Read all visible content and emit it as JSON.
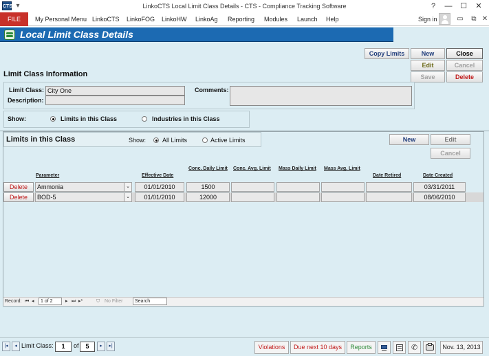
{
  "window": {
    "app_icon": "CTS",
    "title": "LinkoCTS Local Limit Class Details - CTS - Compliance Tracking Software",
    "min_glyph": "—",
    "max_glyph": "☐",
    "close_glyph": "✕"
  },
  "ribbon": {
    "file": "FILE",
    "menus": [
      "My Personal Menu",
      "LinkoCTS",
      "LinkoFOG",
      "LinkoHW",
      "LinkoAg",
      "Reporting",
      "Modules",
      "Launch",
      "Help"
    ],
    "sign_in": "Sign in"
  },
  "header": {
    "title": "Local Limit Class Details"
  },
  "actions": {
    "copy_limits": "Copy Limits",
    "new": "New",
    "close": "Close",
    "edit": "Edit",
    "cancel": "Cancel",
    "save": "Save",
    "delete": "Delete"
  },
  "info": {
    "section_title": "Limit Class Information",
    "limit_class_label": "Limit Class:",
    "limit_class_value": "City One",
    "description_label": "Description:",
    "description_value": "",
    "comments_label": "Comments:",
    "comments_value": "",
    "show_label": "Show:",
    "show_options": [
      "Limits in this Class",
      "Industries in this Class"
    ],
    "show_selected": "Limits in this Class"
  },
  "limits": {
    "title": "Limits in this Class",
    "show_label": "Show:",
    "filter_options": [
      "All Limits",
      "Active Limits"
    ],
    "filter_selected": "All Limits",
    "new": "New",
    "edit": "Edit",
    "cancel": "Cancel",
    "columns": {
      "parameter": "Parameter",
      "effective_date": "Effective Date",
      "conc_daily": "Conc. Daily Limit",
      "conc_avg": "Conc. Avg. Limit",
      "mass_daily": "Mass Daily Limit",
      "mass_avg": "Mass Avg. Limit",
      "date_retired": "Date Retired",
      "date_created": "Date Created"
    },
    "rows": [
      {
        "delete": "Delete",
        "parameter": "Ammonia",
        "effective_date": "01/01/2010",
        "conc_daily": "1500",
        "conc_avg": "",
        "mass_daily": "",
        "mass_avg": "",
        "date_retired": "",
        "date_created": "03/31/2011"
      },
      {
        "delete": "Delete",
        "parameter": "BOD-5",
        "effective_date": "01/01/2010",
        "conc_daily": "12000",
        "conc_avg": "",
        "mass_daily": "",
        "mass_avg": "",
        "date_retired": "",
        "date_created": "08/06/2010"
      }
    ]
  },
  "record_nav": {
    "label": "Record:",
    "position": "1 of 2",
    "filter": "No Filter",
    "search": "Search"
  },
  "status": {
    "limit_class_label": "Limit Class:",
    "current": "1",
    "of_label": "of",
    "total": "5",
    "violations": "Violations",
    "due_next": "Due next 10 days",
    "reports": "Reports",
    "date": "Nov. 13, 2013",
    "colors": {
      "violations": "#c11a1a",
      "reports": "#2e8b3a"
    }
  }
}
